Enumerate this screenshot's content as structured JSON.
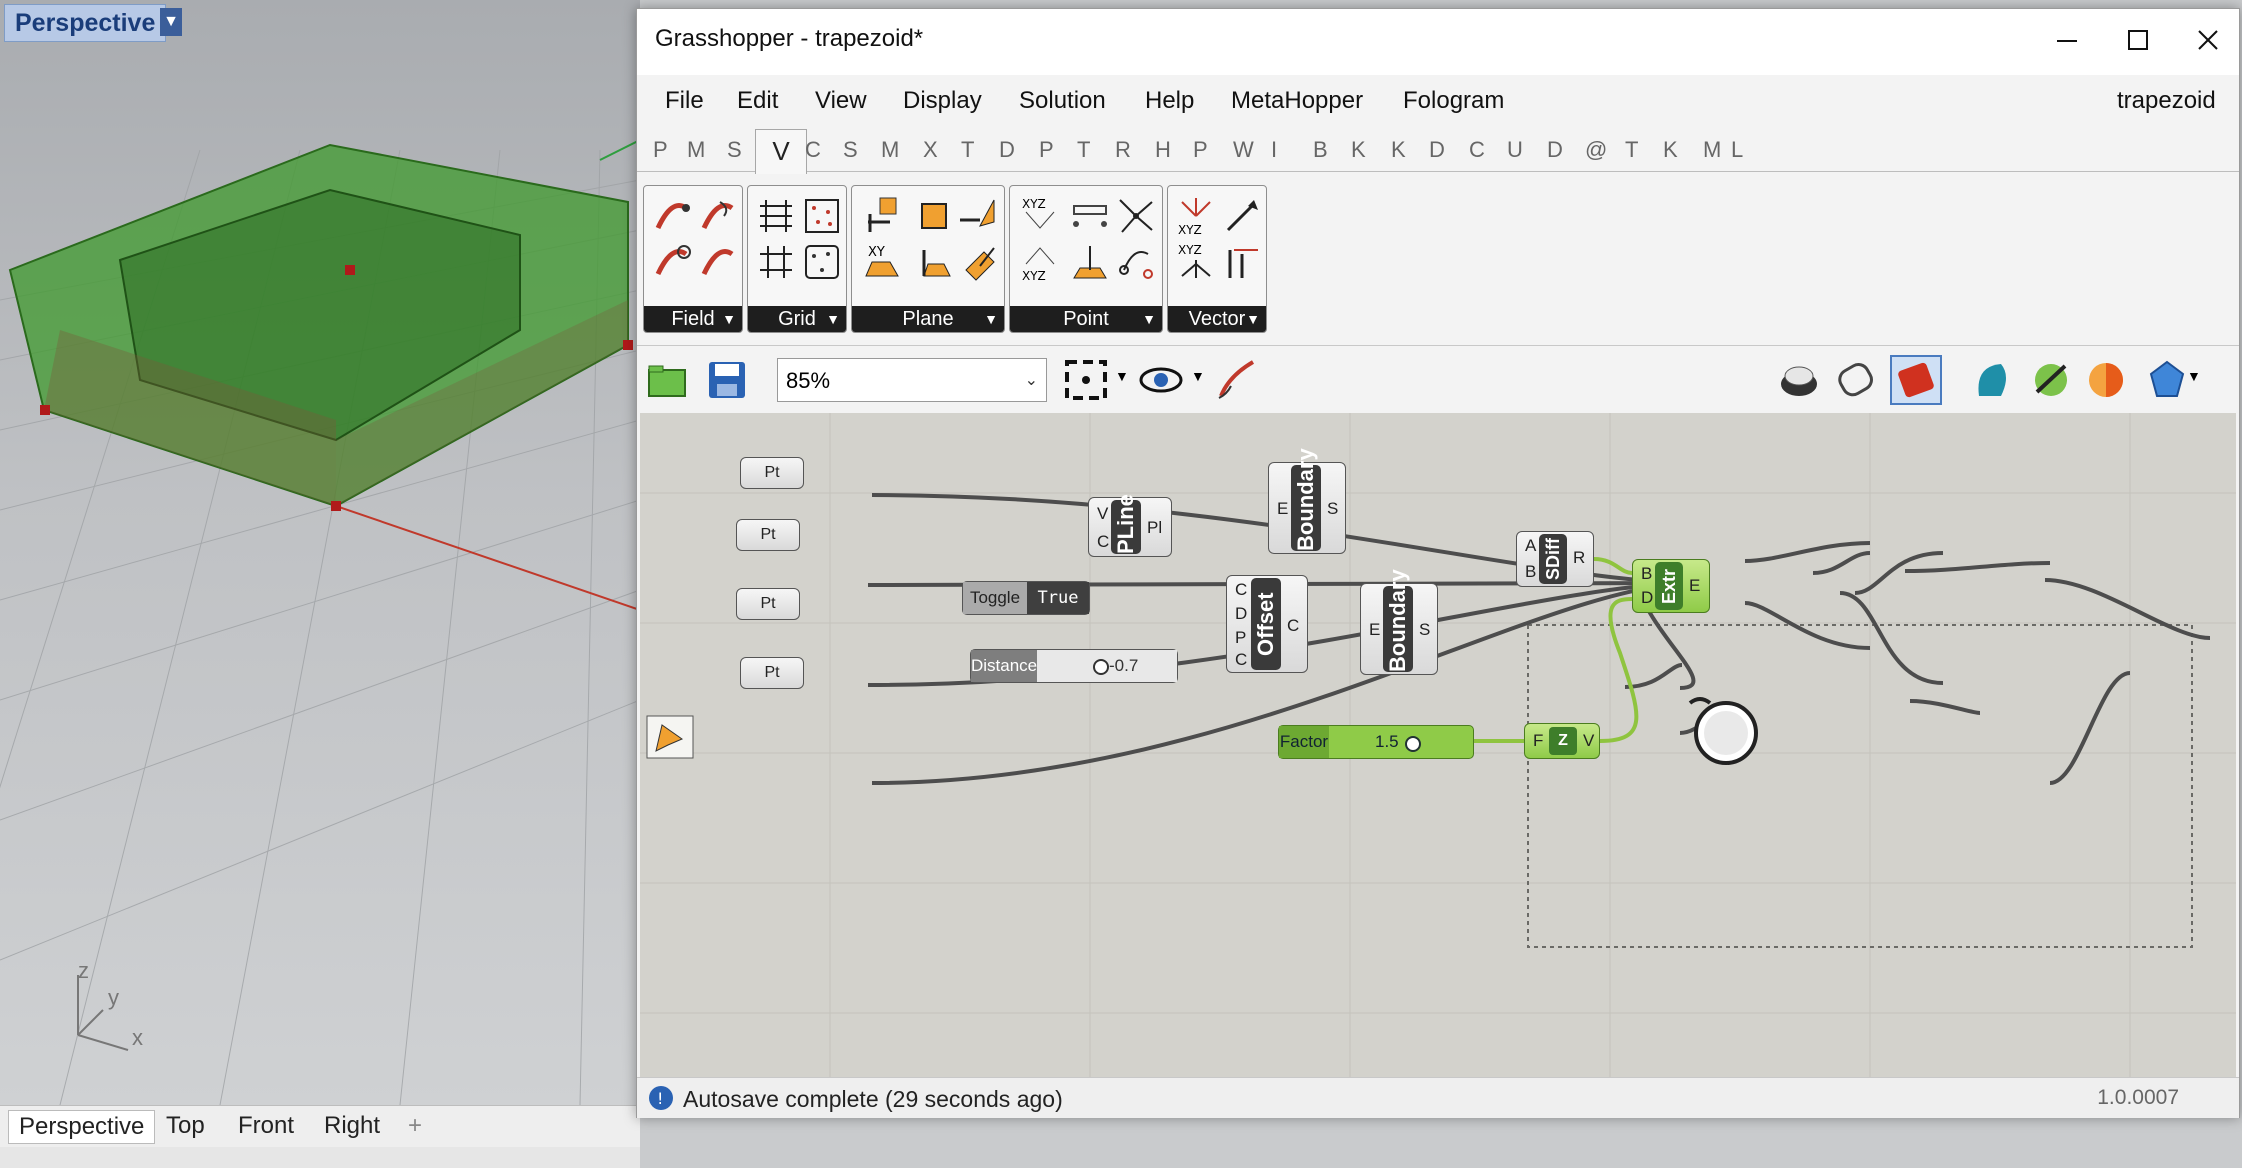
{
  "viewport": {
    "label": "Perspective",
    "axes": {
      "z": "z",
      "y": "y",
      "x": "x"
    },
    "tabs": [
      "Perspective",
      "Top",
      "Front",
      "Right"
    ],
    "add_tab_glyph": "+"
  },
  "window": {
    "title": "Grasshopper - trapezoid*",
    "controls": [
      "minimize-icon",
      "maximize-icon",
      "close-icon"
    ]
  },
  "menu": [
    "File",
    "Edit",
    "View",
    "Display",
    "Solution",
    "Help",
    "MetaHopper",
    "Fologram"
  ],
  "menu_right": "trapezoid",
  "tabs": [
    "P",
    "M",
    "S",
    "V",
    "C",
    "S",
    "M",
    "X",
    "T",
    "D",
    "P",
    "T",
    "R",
    "H",
    "P",
    "W",
    "I",
    "B",
    "K",
    "K",
    "D",
    "C",
    "U",
    "D",
    "@",
    "T",
    "K",
    "M",
    "L"
  ],
  "active_tab": "V",
  "ribbon_panels": [
    {
      "label": "Field"
    },
    {
      "label": "Grid"
    },
    {
      "label": "Plane"
    },
    {
      "label": "Point"
    },
    {
      "label": "Vector"
    }
  ],
  "zoom": "85%",
  "canvas": {
    "points": [
      "Pt",
      "Pt",
      "Pt",
      "Pt"
    ],
    "pline": {
      "name": "PLine",
      "inputs": [
        "V",
        "C"
      ],
      "output": "Pl"
    },
    "boundary1": {
      "name": "Boundary",
      "input": "E",
      "output": "S"
    },
    "boundary2": {
      "name": "Boundary",
      "input": "E",
      "output": "S"
    },
    "offset": {
      "name": "Offset",
      "inputs": [
        "C",
        "D",
        "P",
        "C"
      ],
      "output": "C"
    },
    "sdiff": {
      "name": "SDiff",
      "inputs": [
        "A",
        "B"
      ],
      "output": "R"
    },
    "extr": {
      "name": "Extr",
      "inputs": [
        "B",
        "D"
      ],
      "output": "E"
    },
    "unitz": {
      "name": "Z",
      "input": "F",
      "output": "V"
    },
    "toggle": {
      "label": "Toggle",
      "value": "True"
    },
    "distance": {
      "label": "Distance",
      "value": "-0.7"
    },
    "factor": {
      "label": "Factor",
      "value": "1.5"
    }
  },
  "status": {
    "text": "Autosave complete (29 seconds ago)",
    "version": "1.0.0007"
  },
  "colors": {
    "accent_green": "#8fcb48",
    "wire": "#4d4d4d",
    "wire_green": "#8fc43f"
  }
}
